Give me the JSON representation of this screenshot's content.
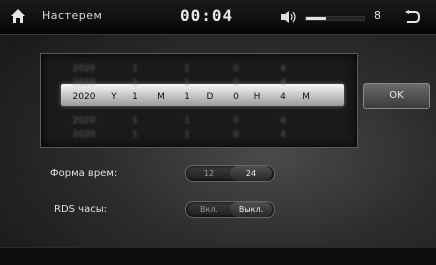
{
  "header": {
    "title": "Настерем",
    "clock": "00:04",
    "volume_level": "8",
    "volume_fraction": 0.34,
    "icons": {
      "home": "home-icon",
      "speaker": "speaker-icon",
      "back": "back-icon"
    }
  },
  "date_picker": {
    "selected": [
      "2020",
      "Y",
      "1",
      "M",
      "1",
      "D",
      "0",
      "H",
      "4",
      "M"
    ]
  },
  "ok_label": "OK",
  "time_format": {
    "label": "Форма врем:",
    "options": [
      "12",
      "24"
    ],
    "selected": "24"
  },
  "rds_clock": {
    "label": "RDS часы:",
    "options": [
      "Вкл.",
      "Выкл."
    ],
    "selected": "Выкл."
  },
  "colors": {
    "accent": "#e0e0e0",
    "background": "#2c2c2c"
  }
}
